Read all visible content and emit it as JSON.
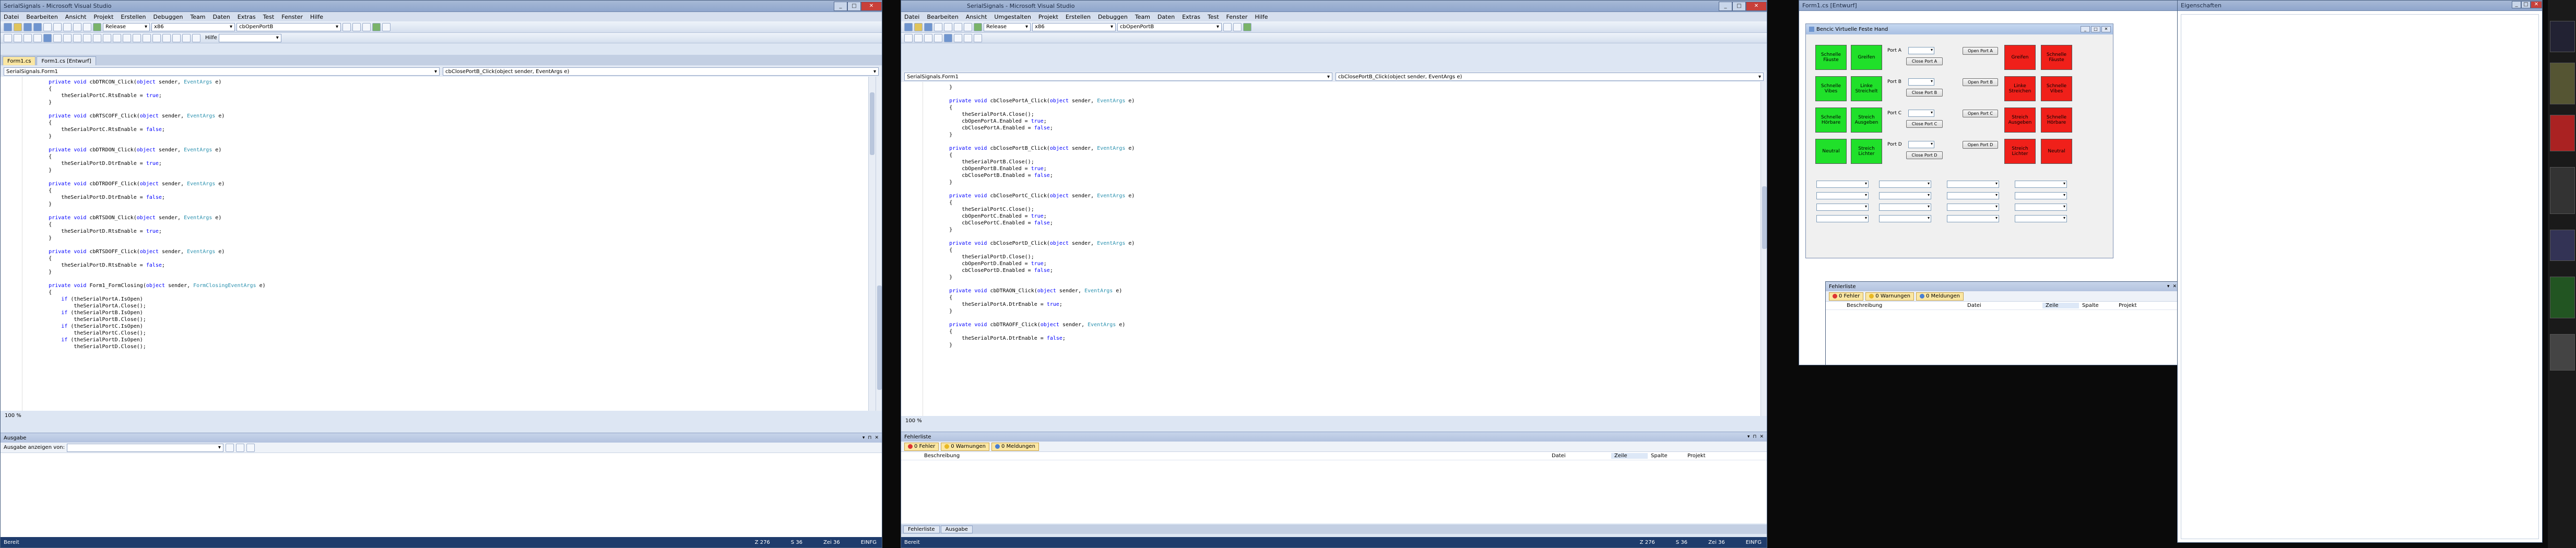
{
  "win1": {
    "title": "SerialSignals - Microsoft Visual Studio",
    "menu": [
      "Datei",
      "Bearbeiten",
      "Ansicht",
      "Projekt",
      "Erstellen",
      "Debuggen",
      "Team",
      "Daten",
      "Extras",
      "Test",
      "Fenster",
      "Hilfe"
    ],
    "config": "Release",
    "platform": "x86",
    "find": "cbOpenPortB",
    "find_label": "Hilfe",
    "tabs": [
      "Form1.cs",
      "Form1.cs [Entwurf]"
    ],
    "nav_left": "SerialSignals.Form1",
    "nav_right": "cbClosePortB_Click(object sender, EventArgs e)",
    "code": [
      [
        "",
        "        private void cbDTRCON_Click(object sender, EventArgs e)"
      ],
      [
        "",
        "        {"
      ],
      [
        "",
        "            theSerialPortC.RtsEnable = true;"
      ],
      [
        "",
        "        }"
      ],
      [
        "",
        ""
      ],
      [
        "",
        "        private void cbRTSCOFF_Click(object sender, EventArgs e)"
      ],
      [
        "",
        "        {"
      ],
      [
        "",
        "            theSerialPortC.RtsEnable = false;"
      ],
      [
        "",
        "        }"
      ],
      [
        "",
        ""
      ],
      [
        "",
        "        private void cbDTRDON_Click(object sender, EventArgs e)"
      ],
      [
        "",
        "        {"
      ],
      [
        "",
        "            theSerialPortD.DtrEnable = true;"
      ],
      [
        "",
        "        }"
      ],
      [
        "",
        ""
      ],
      [
        "",
        "        private void cbDTRDOFF_Click(object sender, EventArgs e)"
      ],
      [
        "",
        "        {"
      ],
      [
        "",
        "            theSerialPortD.DtrEnable = false;"
      ],
      [
        "",
        "        }"
      ],
      [
        "",
        ""
      ],
      [
        "",
        "        private void cbRTSDON_Click(object sender, EventArgs e)"
      ],
      [
        "",
        "        {"
      ],
      [
        "",
        "            theSerialPortD.RtsEnable = true;"
      ],
      [
        "",
        "        }"
      ],
      [
        "",
        ""
      ],
      [
        "",
        "        private void cbRTSDOFF_Click(object sender, EventArgs e)"
      ],
      [
        "",
        "        {"
      ],
      [
        "",
        "            theSerialPortD.RtsEnable = false;"
      ],
      [
        "",
        "        }"
      ],
      [
        "",
        ""
      ],
      [
        "",
        "        private void Form1_FormClosing(object sender, FormClosingEventArgs e)"
      ],
      [
        "",
        "        {"
      ],
      [
        "",
        "            if (theSerialPortA.IsOpen)"
      ],
      [
        "",
        "                theSerialPortA.Close();"
      ],
      [
        "",
        "            if (theSerialPortB.IsOpen)"
      ],
      [
        "",
        "                theSerialPortB.Close();"
      ],
      [
        "",
        "            if (theSerialPortC.IsOpen)"
      ],
      [
        "",
        "                theSerialPortC.Close();"
      ],
      [
        "",
        "            if (theSerialPortD.IsOpen)"
      ],
      [
        "",
        "                theSerialPortD.Close();"
      ]
    ],
    "zoom": "100 %",
    "output_title": "Ausgabe",
    "output_label": "Ausgabe anzeigen von:",
    "status_left": "Bereit",
    "status_ln": "Z 276",
    "status_col": "S 36",
    "status_ch": "Zei 36",
    "status_mode": "EINFG"
  },
  "win2": {
    "title": "SerialSignals - Microsoft Visual Studio",
    "menu": [
      "Datei",
      "Bearbeiten",
      "Ansicht",
      "Umgestalten",
      "Projekt",
      "Erstellen",
      "Debuggen",
      "Team",
      "Daten",
      "Extras",
      "Test",
      "Fenster",
      "Hilfe"
    ],
    "config": "Release",
    "platform": "x86",
    "find": "cbOpenPortB",
    "nav_left": "SerialSignals.Form1",
    "nav_right": "cbClosePortB_Click(object sender, EventArgs e)",
    "code": [
      "        }",
      "",
      "        private void cbClosePortA_Click(object sender, EventArgs e)",
      "        {",
      "            theSerialPortA.Close();",
      "            cbOpenPortA.Enabled = true;",
      "            cbClosePortA.Enabled = false;",
      "        }",
      "",
      "        private void cbClosePortB_Click(object sender, EventArgs e)",
      "        {",
      "            theSerialPortB.Close();",
      "            cbOpenPortB.Enabled = true;",
      "            cbClosePortB.Enabled = false;",
      "        }",
      "",
      "        private void cbClosePortC_Click(object sender, EventArgs e)",
      "        {",
      "            theSerialPortC.Close();",
      "            cbOpenPortC.Enabled = true;",
      "            cbClosePortC.Enabled = false;",
      "        }",
      "",
      "        private void cbClosePortD_Click(object sender, EventArgs e)",
      "        {",
      "            theSerialPortD.Close();",
      "            cbOpenPortD.Enabled = true;",
      "            cbClosePortD.Enabled = false;",
      "        }",
      "",
      "        private void cbDTRAON_Click(object sender, EventArgs e)",
      "        {",
      "            theSerialPortA.DtrEnable = true;",
      "        }",
      "",
      "        private void cbDTRAOFF_Click(object sender, EventArgs e)",
      "        {",
      "            theSerialPortA.DtrEnable = false;",
      "        }"
    ],
    "zoom": "100 %",
    "errlist_title": "Fehlerliste",
    "filters": [
      "0 Fehler",
      "0 Warnungen",
      "0 Meldungen"
    ],
    "columns": [
      "Beschreibung",
      "Datei",
      "Zeile",
      "Spalte",
      "Projekt"
    ],
    "bottom_tabs": [
      "Fehlerliste",
      "Ausgabe"
    ],
    "status_left": "Bereit",
    "status_ln": "Z 276",
    "status_col": "S 36",
    "status_ch": "Zei 36",
    "status_mode": "EINFG"
  },
  "win3": {
    "title": "Form1.cs [Entwurf]",
    "form_title": "Bencic Virtuelle Feste Hand",
    "ports": [
      "Port A",
      "Port B",
      "Port C",
      "Port D"
    ],
    "open_buttons": [
      "Open Port A",
      "Open Port B",
      "Open Port C",
      "Open Port D"
    ],
    "close_buttons": [
      "Close Port A",
      "Close Port B",
      "Close Port C",
      "Close Port D"
    ],
    "green_buttons": [
      [
        "Schnelle Fäuste",
        "Greifen"
      ],
      [
        "Schnelle Vibes",
        "Linke Streichelt"
      ],
      [
        "Schnelle Hörbare",
        "Streich Ausgeben"
      ],
      [
        "Neutral",
        "Streich Lichter"
      ]
    ],
    "red_buttons": [
      [
        "Greifen",
        "Schnelle Fäuste"
      ],
      [
        "Linke Streichen",
        "Schnelle Vibes"
      ],
      [
        "Streich Ausgeben",
        "Schnelle Hörbare"
      ],
      [
        "Streich Lichter",
        "Neutral"
      ]
    ],
    "err_title": "Fehlerliste",
    "filters": [
      "0 Fehler",
      "0 Warnungen",
      "0 Meldungen"
    ],
    "columns": [
      "Beschreibung",
      "Datei",
      "Zeile",
      "Spalte",
      "Projekt"
    ]
  },
  "win4": {
    "title": "Eigenschaften"
  }
}
